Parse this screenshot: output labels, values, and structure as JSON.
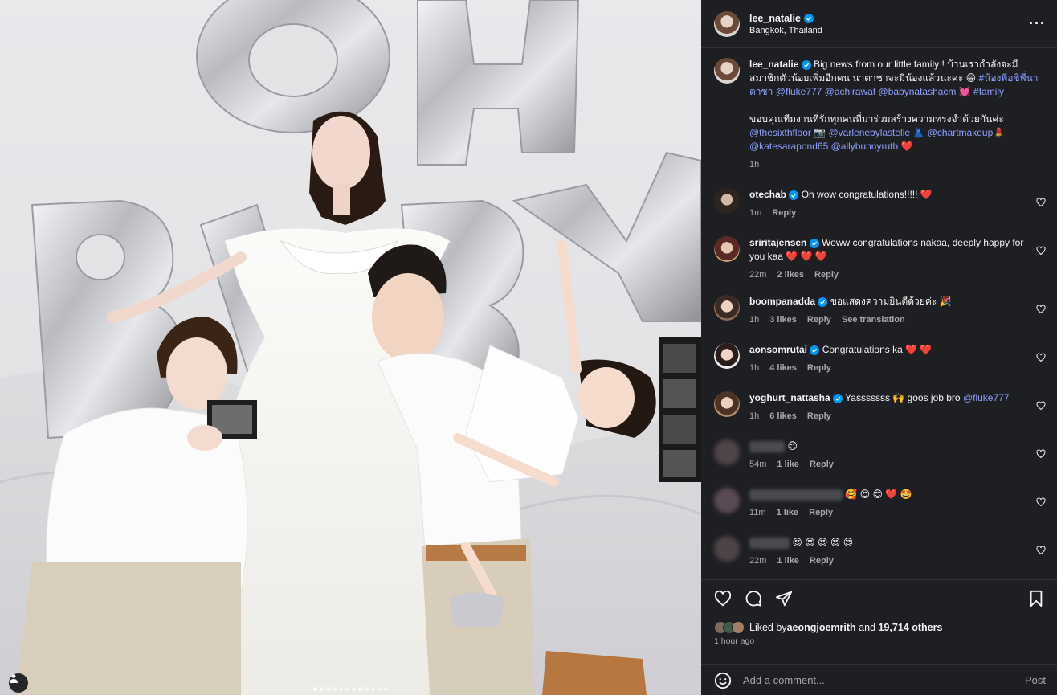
{
  "header": {
    "username": "lee_natalie",
    "location": "Bangkok, Thailand",
    "more_icon": "ellipsis-icon"
  },
  "photo": {
    "balloon_text_top": "OH",
    "balloon_text_bottom": "BABY",
    "carousel_count": 12,
    "carousel_active": 0
  },
  "caption": {
    "username": "lee_natalie",
    "text_1": "Big news from our little family ! บ้านเรากำลังจะมีสมาชิกตัวน้อยเพิ่มอีกคน นาตาชาจะมีน้องแล้วนะคะ 😁 ",
    "hashtag_1": "#น้องพี่อชิพี่นาตาชา",
    "mentions_1": "@fluke777 @achirawat @babynatashacm",
    "heart_1": " 💓 ",
    "hashtag_2": "#family",
    "text_2": "ขอบคุณทีมงานที่รักทุกคนที่มาร่วมสร้างความทรงจำด้วยกันค่ะ",
    "mention_a": "@thesixthfloor",
    "emoji_a": " 📷 ",
    "mention_b": "@varlenebylastelle",
    "emoji_b": " 👗 ",
    "mention_c": "@chartmakeup",
    "emoji_c": "💄",
    "mention_d": "@katesarapond65",
    "mention_e": "@allybunnyruth",
    "emoji_e": " ❤️",
    "time": "1h"
  },
  "comments": [
    {
      "username": "otechab",
      "text": "Oh wow congratulations!!!!! ❤️",
      "time": "1m",
      "likes": "",
      "reply": "Reply",
      "extra": ""
    },
    {
      "username": "sriritajensen",
      "text": "Woww congratulations nakaa, deeply happy for you kaa ❤️ ❤️ ❤️",
      "time": "22m",
      "likes": "2 likes",
      "reply": "Reply",
      "extra": ""
    },
    {
      "username": "boompanadda",
      "text": "ขอแสดงความยินดีด้วยค่ะ 🎉",
      "time": "1h",
      "likes": "3 likes",
      "reply": "Reply",
      "extra": "See translation"
    },
    {
      "username": "aonsomrutai",
      "text": "Congratulations ka ❤️ ❤️",
      "time": "1h",
      "likes": "4 likes",
      "reply": "Reply",
      "extra": ""
    },
    {
      "username": "yoghurt_nattasha",
      "text": "Yasssssss 🙌 goos job bro ",
      "mention": "@fluke777",
      "time": "1h",
      "likes": "6 likes",
      "reply": "Reply",
      "extra": ""
    },
    {
      "username": "",
      "text": "😍",
      "time": "54m",
      "likes": "1 like",
      "reply": "Reply",
      "extra": ""
    },
    {
      "username": "",
      "text": "🥰 😍 😍 ❤️ 🤩",
      "time": "11m",
      "likes": "1 like",
      "reply": "Reply",
      "extra": ""
    },
    {
      "username": "",
      "text": "😍 😍 😍 😍 😍",
      "time": "22m",
      "likes": "1 like",
      "reply": "Reply",
      "extra": ""
    }
  ],
  "footer": {
    "liked_by_prefix": "Liked by ",
    "liked_by_user": "aeongjoemrith",
    "and_text": " and ",
    "others": "19,714 others",
    "time_ago": "1 hour ago",
    "add_comment_placeholder": "Add a comment...",
    "post_label": "Post"
  },
  "colors": {
    "panel_bg": "#1e1f22",
    "link": "#8da0ff",
    "verified": "#0095f6",
    "muted": "#a8a8a8"
  }
}
